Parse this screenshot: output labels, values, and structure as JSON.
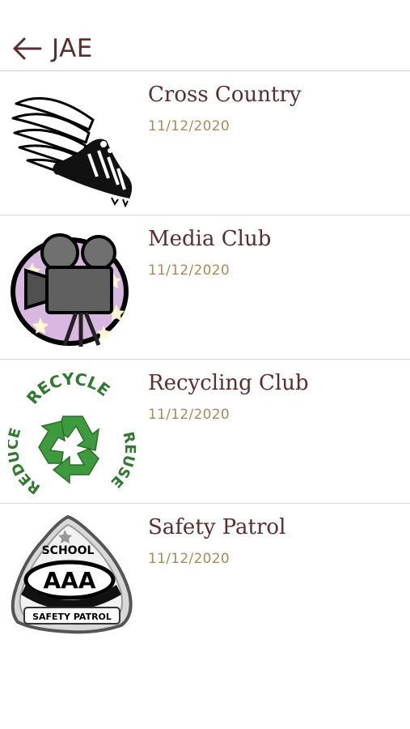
{
  "header": {
    "back_icon": "arrow-left-icon",
    "title": "JAE"
  },
  "colors": {
    "title": "#5a2e2e",
    "date": "#a88a5c",
    "divider": "#d9d9d9"
  },
  "items": [
    {
      "title": "Cross Country",
      "date": "11/12/2020",
      "icon": "winged-shoe-icon"
    },
    {
      "title": "Media Club",
      "date": "11/12/2020",
      "icon": "film-camera-icon"
    },
    {
      "title": "Recycling Club",
      "date": "11/12/2020",
      "icon": "recycle-icon",
      "logo_text": [
        "RECYCLE",
        "REUSE",
        "REDUCE"
      ]
    },
    {
      "title": "Safety Patrol",
      "date": "11/12/2020",
      "icon": "safety-patrol-badge-icon",
      "logo_text": [
        "SCHOOL",
        "AAA",
        "SAFETY PATROL"
      ]
    }
  ]
}
